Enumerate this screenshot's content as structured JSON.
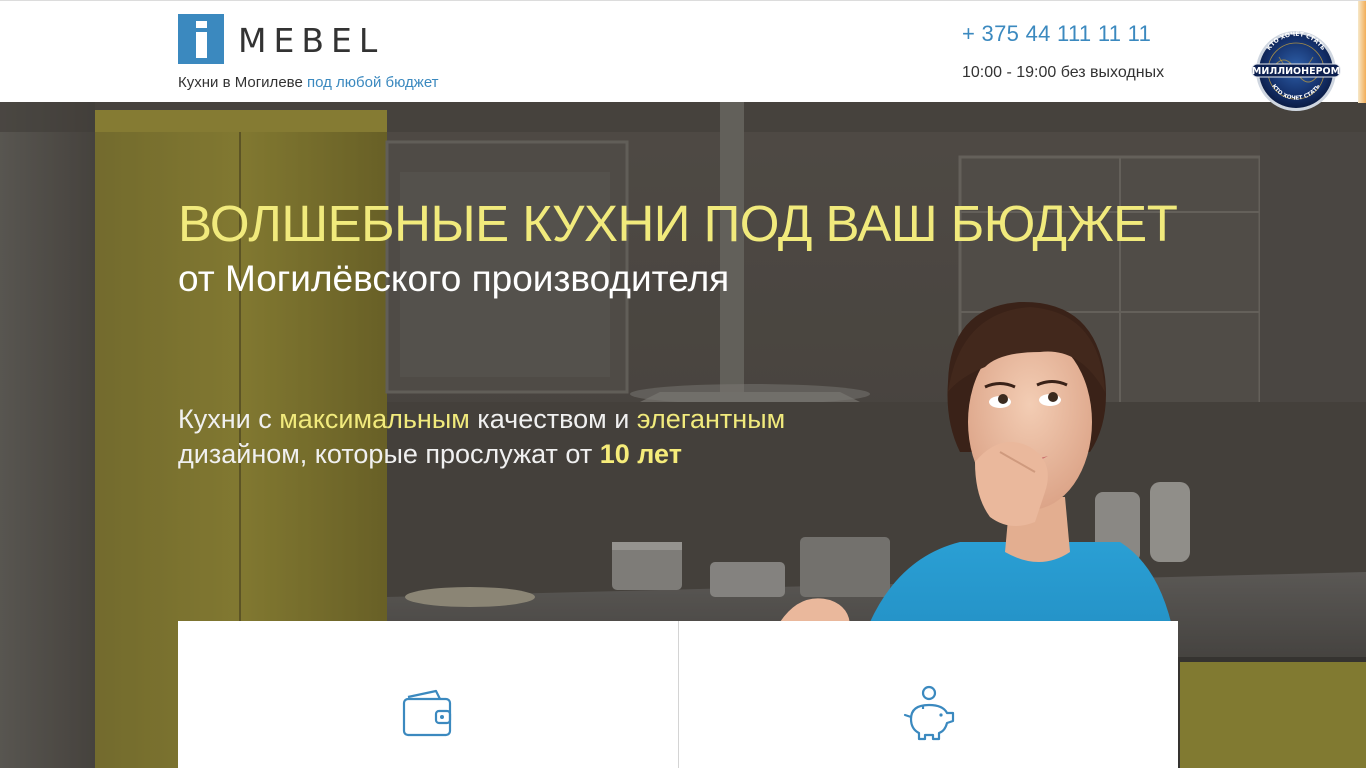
{
  "header": {
    "logo_text": "MEBEL",
    "logo_letter": "i",
    "tagline_prefix": "Кухни в Могилеве",
    "tagline_accent": "под любой бюджет",
    "phone": "+ 375 44 111 11 11",
    "hours": "10:00 - 19:00 без выходных",
    "badge": {
      "text_top": "КТО ХОЧЕТ СТАТЬ",
      "text_main": "МИЛЛИОНЕРОМ",
      "text_bottom": "КТО ХОЧЕТ СТАТЬ"
    }
  },
  "hero": {
    "headline": "ВОЛШЕБНЫЕ КУХНИ ПОД ВАШ БЮДЖЕТ",
    "subheadline": "от Могилёвского производителя",
    "desc": {
      "part1": "Кухни с ",
      "hl1": "максимальным",
      "part2": " качеством и ",
      "hl2": "элегантным",
      "part3": " дизайном, которые прослужат от ",
      "hl3": "10 лет"
    }
  },
  "cards": [
    {
      "icon": "wallet-icon"
    },
    {
      "icon": "piggy-bank-icon"
    }
  ],
  "colors": {
    "brand_blue": "#3b89bf",
    "headline_yellow": "#f1ea7c",
    "shirt_blue": "#2596c9",
    "cabinet_yellow": "#b8a82a"
  }
}
